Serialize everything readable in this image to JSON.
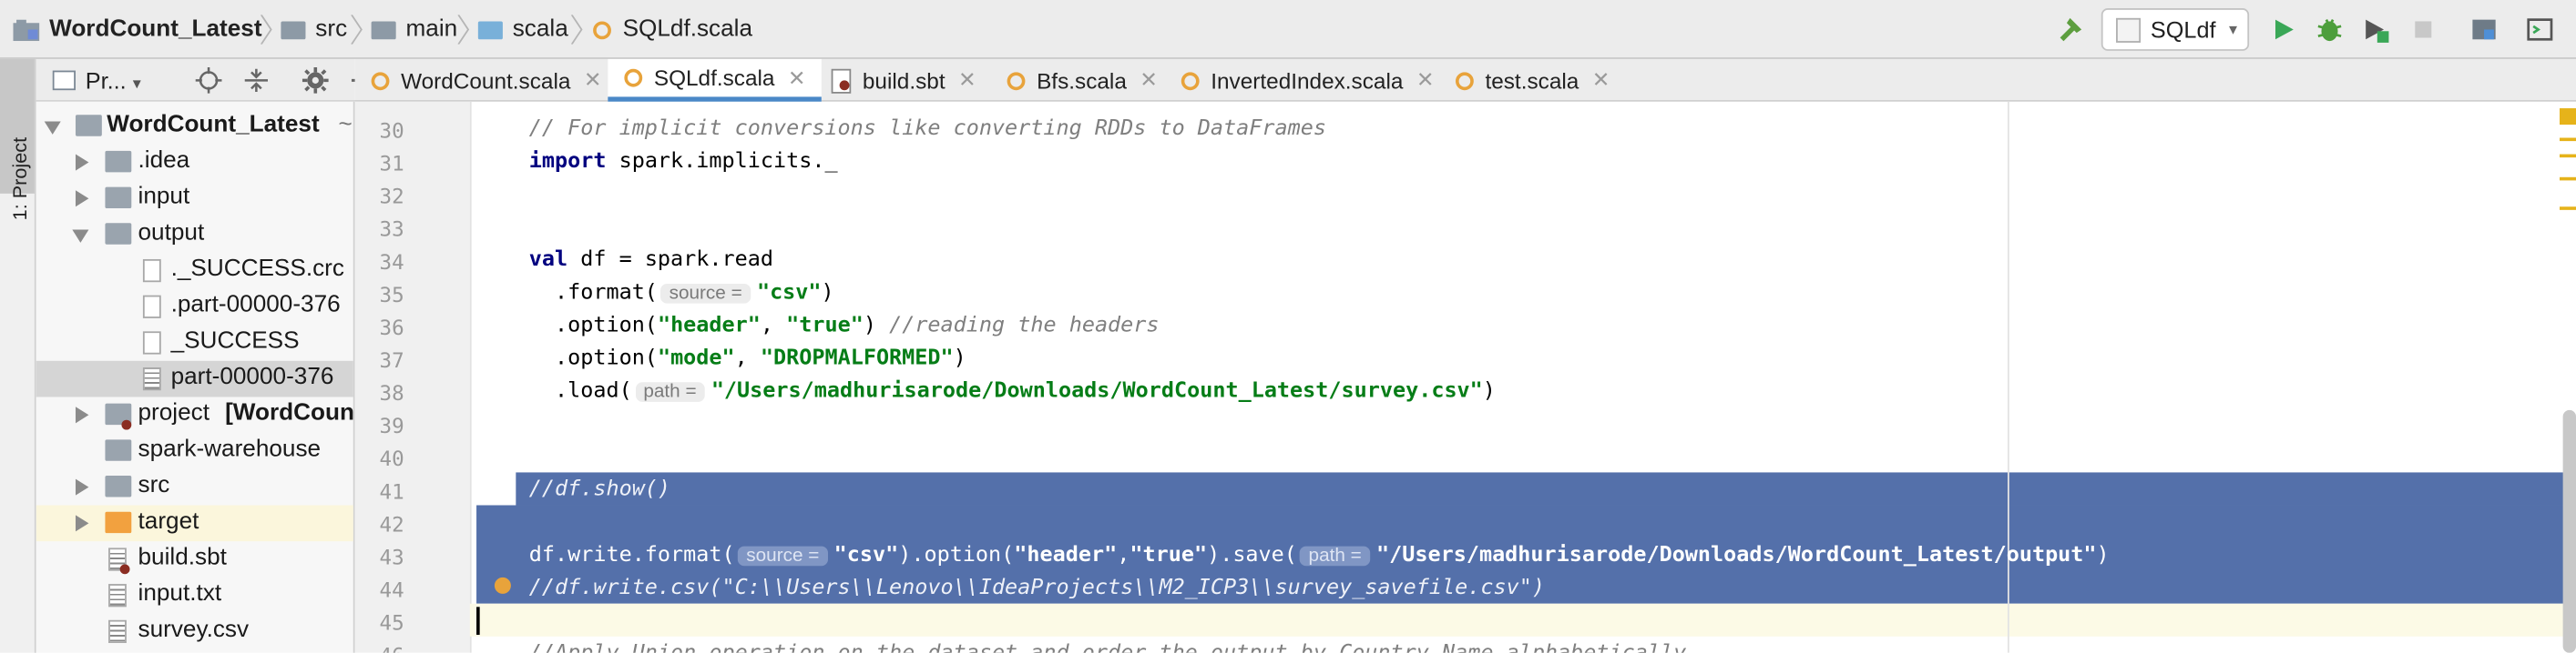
{
  "navbar": {
    "crumbs": [
      "WordCount_Latest",
      "src",
      "main",
      "scala",
      "SQLdf.scala"
    ],
    "run_config": "SQLdf"
  },
  "sidebar": {
    "stripe_label": "1: Project",
    "panel_title": "Pr...",
    "tree": [
      {
        "label": "WordCount_Latest",
        "suffix": "~",
        "kind": "project"
      },
      {
        "label": ".idea",
        "kind": "folder"
      },
      {
        "label": "input",
        "kind": "folder"
      },
      {
        "label": "output",
        "kind": "folder"
      },
      {
        "label": "._SUCCESS.crc",
        "kind": "file"
      },
      {
        "label": ".part-00000-376",
        "kind": "file"
      },
      {
        "label": "_SUCCESS",
        "kind": "file"
      },
      {
        "label": "part-00000-376",
        "kind": "file"
      },
      {
        "label": "project",
        "suffix": "[WordCoun",
        "kind": "folder"
      },
      {
        "label": "spark-warehouse",
        "kind": "folder"
      },
      {
        "label": "src",
        "kind": "folder"
      },
      {
        "label": "target",
        "kind": "folder"
      },
      {
        "label": "build.sbt",
        "kind": "file"
      },
      {
        "label": "input.txt",
        "kind": "file"
      },
      {
        "label": "survey.csv",
        "kind": "file"
      }
    ]
  },
  "tabs": [
    "WordCount.scala",
    "SQLdf.scala",
    "build.sbt",
    "Bfs.scala",
    "InvertedIndex.scala",
    "test.scala"
  ],
  "editor": {
    "line_numbers": [
      "30",
      "31",
      "32",
      "33",
      "34",
      "35",
      "36",
      "37",
      "38",
      "39",
      "40",
      "41",
      "42",
      "43",
      "44",
      "45",
      "46"
    ],
    "lines": {
      "l30": "// For implicit conversions like converting RDDs to DataFrames",
      "l31_kw": "import",
      "l31": " spark.implicits._",
      "l34_kw": "val",
      "l34": " df = spark.read",
      "l35_a": "  .format(",
      "l35_hint": "source =",
      "l35_str": "\"csv\"",
      "l35_b": ")",
      "l36_a": "  .option(",
      "l36_s1": "\"header\"",
      "l36_b": ", ",
      "l36_s2": "\"true\"",
      "l36_c": ") ",
      "l36_cm": "//reading the headers",
      "l37_a": "  .option(",
      "l37_s1": "\"mode\"",
      "l37_b": ", ",
      "l37_s2": "\"DROPMALFORMED\"",
      "l37_c": ")",
      "l38_a": "  .load(",
      "l38_hint": "path =",
      "l38_str": "\"/Users/madhurisarode/Downloads/WordCount_Latest/survey.csv\"",
      "l38_b": ")",
      "l41": "//df.show()",
      "l43_a": "df.write.format(",
      "l43_hint1": "source =",
      "l43_s1": "\"csv\"",
      "l43_b": ").option(",
      "l43_s2": "\"header\"",
      "l43_c": ",",
      "l43_s3": "\"true\"",
      "l43_d": ").save(",
      "l43_hint2": "path =",
      "l43_s4": "\"/Users/madhurisarode/Downloads/WordCount_Latest/output\"",
      "l43_e": ")",
      "l44": "//df.write.csv(\"C:\\\\Users\\\\Lenovo\\\\IdeaProjects\\\\M2_ICP3\\\\survey_savefile.csv\")",
      "l46": "//Apply Union operation on the dataset and order the output by Country Name alphabetically"
    }
  },
  "colors": {
    "selection": "#5470aa",
    "keyword": "#00007f",
    "string": "#067d17",
    "comment": "#7f7f7f",
    "accent_tab": "#4a88c7"
  }
}
